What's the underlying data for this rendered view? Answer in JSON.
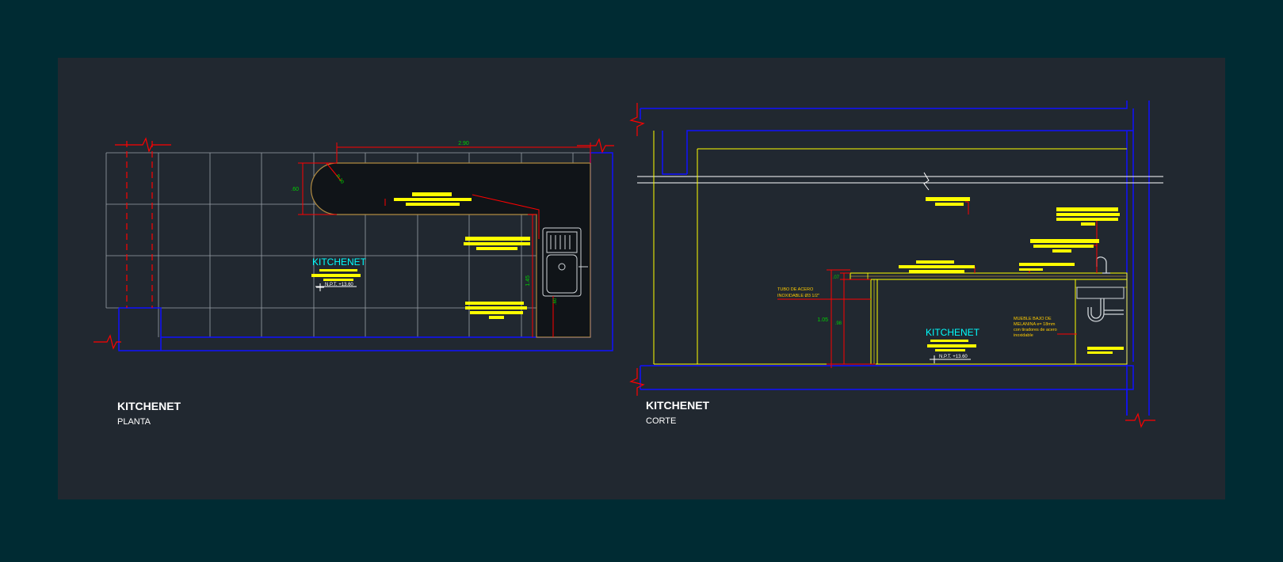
{
  "colors": {
    "outer_bg": "#002b33",
    "canvas_bg": "#212830",
    "wall": "#1010ff",
    "dimension": "#ff0000",
    "dim_text": "#00d000",
    "grid": "#9aa0a8",
    "counter": "#ffff00",
    "room_label": "#00ffff",
    "title": "#ffffff",
    "note": "#ffcc00"
  },
  "plan": {
    "title": "KITCHENET",
    "subtitle": "PLANTA",
    "room_label": "KITCHENET",
    "level": "N.P.T. +13.60",
    "dim_width": "2.90",
    "dim_depth": ".60",
    "dim_height": "1.45",
    "dim_inner": ".60",
    "dim_radius": "R.30"
  },
  "section": {
    "title": "KITCHENET",
    "subtitle": "CORTE",
    "room_label": "KITCHENET",
    "level": "N.P.T. +13.60",
    "dim_total": "1.05",
    "dim_top": ".07",
    "dim_leg": ".98",
    "note_tube_1": "TUBO DE ACERO",
    "note_tube_2": "INOXIDABLE Ø3 1/2\"",
    "note_cab_1": "MUEBLE BAJO DE",
    "note_cab_2": "MELANINA e= 18mm",
    "note_cab_3": "con tiradores de acero",
    "note_cab_4": "inoxidable"
  }
}
